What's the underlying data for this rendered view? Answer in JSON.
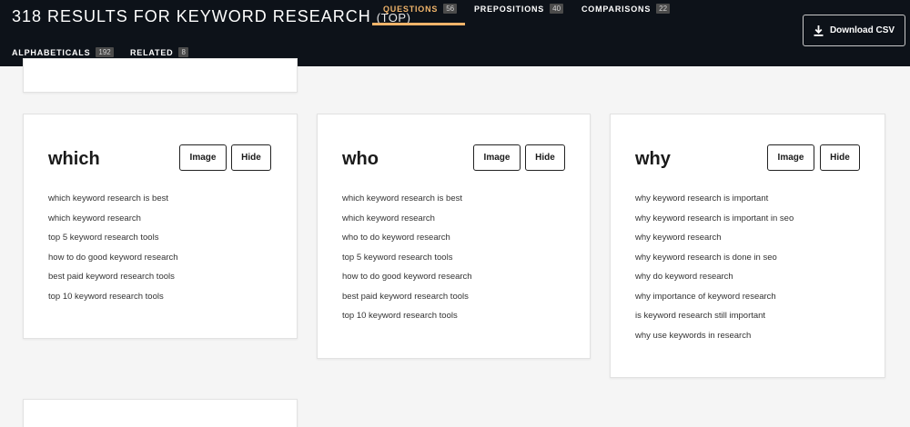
{
  "header": {
    "title": "318 RESULTS FOR KEYWORD RESEARCH",
    "title_suffix": "(TOP)",
    "download_label": "Download CSV",
    "accent_color": "#f0b46a",
    "tabs": [
      {
        "label": "QUESTIONS",
        "count": "56",
        "active": true
      },
      {
        "label": "PREPOSITIONS",
        "count": "40",
        "active": false
      },
      {
        "label": "COMPARISONS",
        "count": "22",
        "active": false
      },
      {
        "label": "ALPHABETICALS",
        "count": "192",
        "active": false
      },
      {
        "label": "RELATED",
        "count": "8",
        "active": false
      }
    ]
  },
  "icons": {
    "download": "download-icon"
  },
  "cards": [
    {
      "heading": "which",
      "image_label": "Image",
      "hide_label": "Hide",
      "items": [
        "which keyword research is best",
        "which keyword research",
        "top 5 keyword research tools",
        "how to do good keyword research",
        "best paid keyword research tools",
        "top 10 keyword research tools"
      ]
    },
    {
      "heading": "who",
      "image_label": "Image",
      "hide_label": "Hide",
      "items": [
        "which keyword research is best",
        "which keyword research",
        "who to do keyword research",
        "top 5 keyword research tools",
        "how to do good keyword research",
        "best paid keyword research tools",
        "top 10 keyword research tools"
      ]
    },
    {
      "heading": "why",
      "image_label": "Image",
      "hide_label": "Hide",
      "items": [
        "why keyword research is important",
        "why keyword research is important in seo",
        "why keyword research",
        "why keyword research is done in seo",
        "why do keyword research",
        "why importance of keyword research",
        "is keyword research still important",
        "why use keywords in research"
      ]
    }
  ]
}
